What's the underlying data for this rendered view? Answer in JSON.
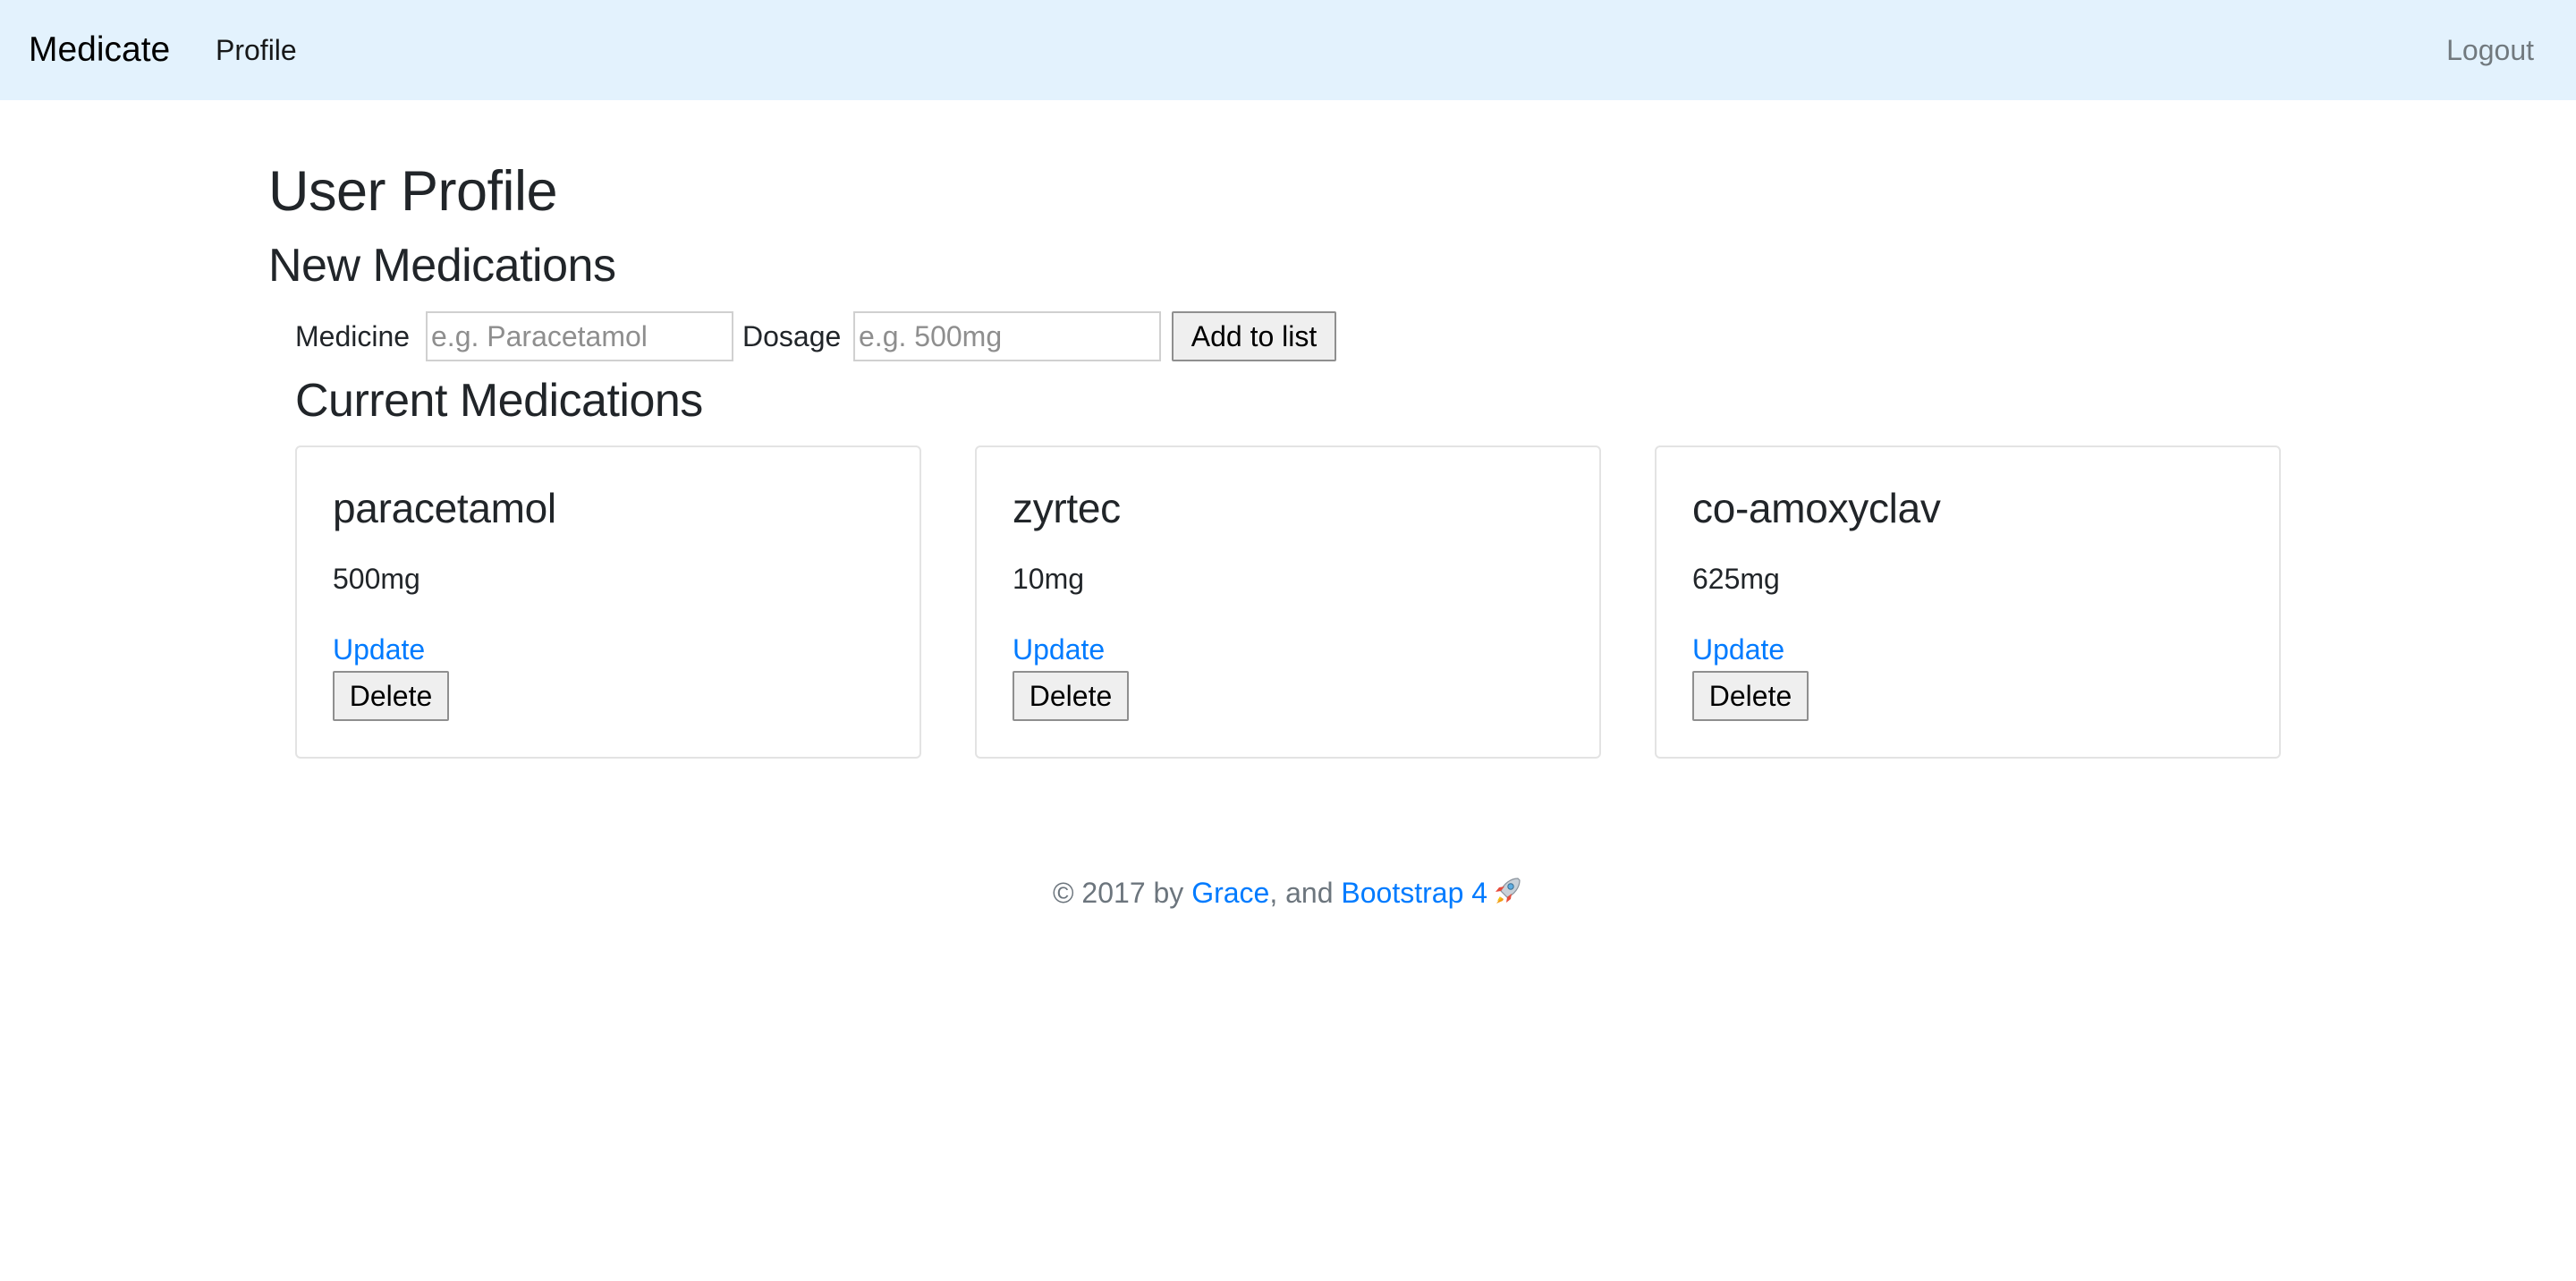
{
  "nav": {
    "brand": "Medicate",
    "profile": "Profile",
    "logout": "Logout"
  },
  "page": {
    "title": "User Profile",
    "new_heading": "New Medications",
    "current_heading": "Current Medications"
  },
  "form": {
    "medicine_label": "Medicine",
    "medicine_placeholder": "e.g. Paracetamol",
    "medicine_value": "",
    "dosage_label": "Dosage",
    "dosage_placeholder": "e.g. 500mg",
    "dosage_value": "",
    "submit_label": "Add to list"
  },
  "medications": [
    {
      "name": "paracetamol",
      "dosage": "500mg",
      "update_label": "Update",
      "delete_label": "Delete"
    },
    {
      "name": "zyrtec",
      "dosage": "10mg",
      "update_label": "Update",
      "delete_label": "Delete"
    },
    {
      "name": "co-amoxyclav",
      "dosage": "625mg",
      "update_label": "Update",
      "delete_label": "Delete"
    }
  ],
  "footer": {
    "prefix": "© 2017 by ",
    "author": "Grace",
    "middle": ", and ",
    "framework": "Bootstrap 4",
    "icon": "rocket-icon"
  },
  "colors": {
    "navbar_bg": "#e3f2fd",
    "link": "#007bff",
    "muted": "#6c757d"
  }
}
